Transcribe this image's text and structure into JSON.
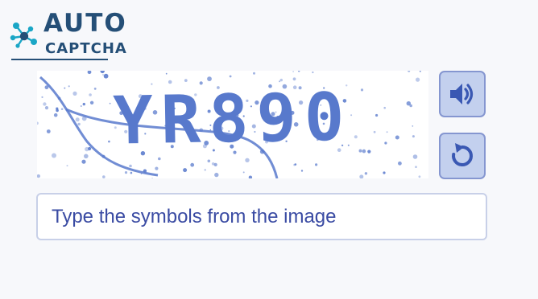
{
  "logo": {
    "title": "AUTO",
    "subtitle": "CAPTCHA",
    "icon": "molecule-icon"
  },
  "captcha": {
    "challenge_text": "YR890"
  },
  "buttons": {
    "audio_icon": "speaker-icon",
    "refresh_icon": "refresh-icon"
  },
  "answer": {
    "value": "",
    "placeholder": "Type the symbols from the image"
  },
  "colors": {
    "brand": "#254f77",
    "accent": "#8596d0",
    "button_fill": "#c3d0ee",
    "text": "#3a4ba3",
    "captcha_glyphs": "#5879cc"
  }
}
